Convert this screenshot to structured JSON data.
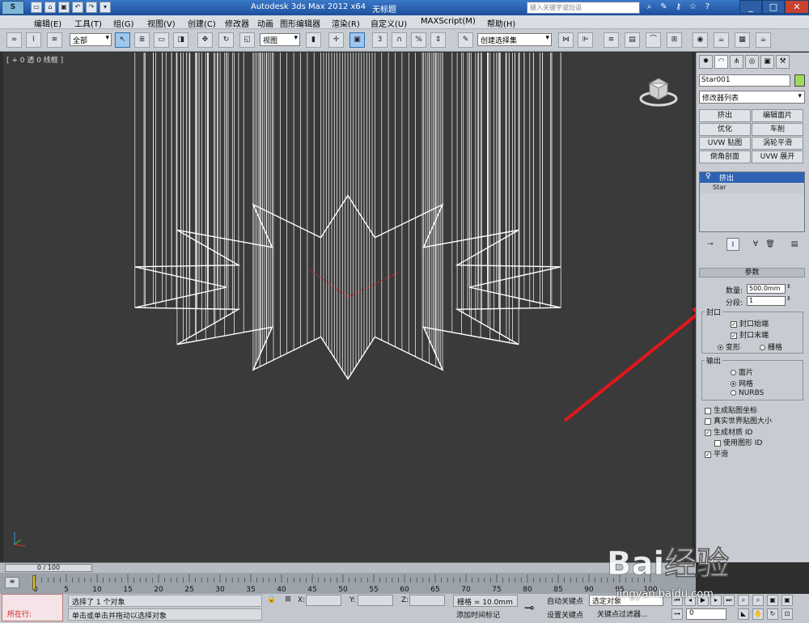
{
  "titlebar": {
    "app_logo": "3ds Max logo",
    "quick_access": [
      "new",
      "open",
      "save",
      "undo",
      "redo",
      "more"
    ],
    "title": "Autodesk 3ds Max  2012 x64",
    "file": "无标题",
    "search_placeholder": "键入关键字或短语",
    "right_icons": [
      "binoculars-icon",
      "wrench-icon",
      "key-icon",
      "star-icon",
      "help-icon"
    ],
    "window_buttons": [
      "_",
      "□",
      "✕"
    ]
  },
  "menu": [
    "编辑(E)",
    "工具(T)",
    "组(G)",
    "视图(V)",
    "创建(C)",
    "修改器",
    "动画",
    "图形编辑器",
    "渲染(R)",
    "自定义(U)",
    "MAXScript(M)",
    "帮助(H)"
  ],
  "toolbar": {
    "selection_filter": "全部",
    "ref_coord": "视图",
    "named_selection": "创建选择集"
  },
  "viewport": {
    "label": "[ + 0 透 0 线框 ]",
    "object": "Star001 extrude wireframe"
  },
  "command_panel": {
    "tabs": [
      "create",
      "modify",
      "hierarchy",
      "motion",
      "display",
      "utilities"
    ],
    "object_name": "Star001",
    "object_color": "#a3d95a",
    "modifier_list": "修改器列表",
    "modifier_buttons": [
      "挤出",
      "编辑面片",
      "优化",
      "车削",
      "UVW 贴图",
      "涡轮平滑",
      "倒角剖面",
      "UVW 展开"
    ],
    "stack": [
      "挤出",
      "Star"
    ],
    "rollout_title": "参数",
    "amount_label": "数量:",
    "amount_value": "500.0mm",
    "segments_label": "分段:",
    "segments_value": "1",
    "capping_label": "封口",
    "cap_start": "封口始端",
    "cap_end": "封口末端",
    "morph": "变形",
    "grid": "栅格",
    "output_label": "输出",
    "out_patch": "面片",
    "out_mesh": "网格",
    "out_nurbs": "NURBS",
    "gen_map_coords": "生成贴图坐标",
    "real_world": "真实世界贴图大小",
    "gen_mat_id": "生成材质 ID",
    "use_shape_id": "使用图形 ID",
    "smooth": "平滑"
  },
  "timeline": {
    "slider": "0 / 100",
    "ticks": [
      "0",
      "5",
      "10",
      "15",
      "20",
      "25",
      "30",
      "35",
      "40",
      "45",
      "50",
      "55",
      "60",
      "65",
      "70",
      "75",
      "80",
      "85",
      "90",
      "95",
      "100"
    ]
  },
  "status": {
    "maxscript_text": "所在行:",
    "line1": "选择了 1 个对象",
    "line2": "单击或单击并拖动以选择对象",
    "x_label": "X:",
    "y_label": "Y:",
    "z_label": "Z:",
    "grid": "栅格 = 10.0mm",
    "add_time_tag": "添加时间标记",
    "auto_key": "自动关键点",
    "set_key": "设置关键点",
    "selected_dropdown": "选定对象",
    "key_filters": "关键点过滤器...",
    "frame_value": "0"
  },
  "watermark": {
    "brand": "Bai经验",
    "domain": "jingyan.baidu.com"
  }
}
